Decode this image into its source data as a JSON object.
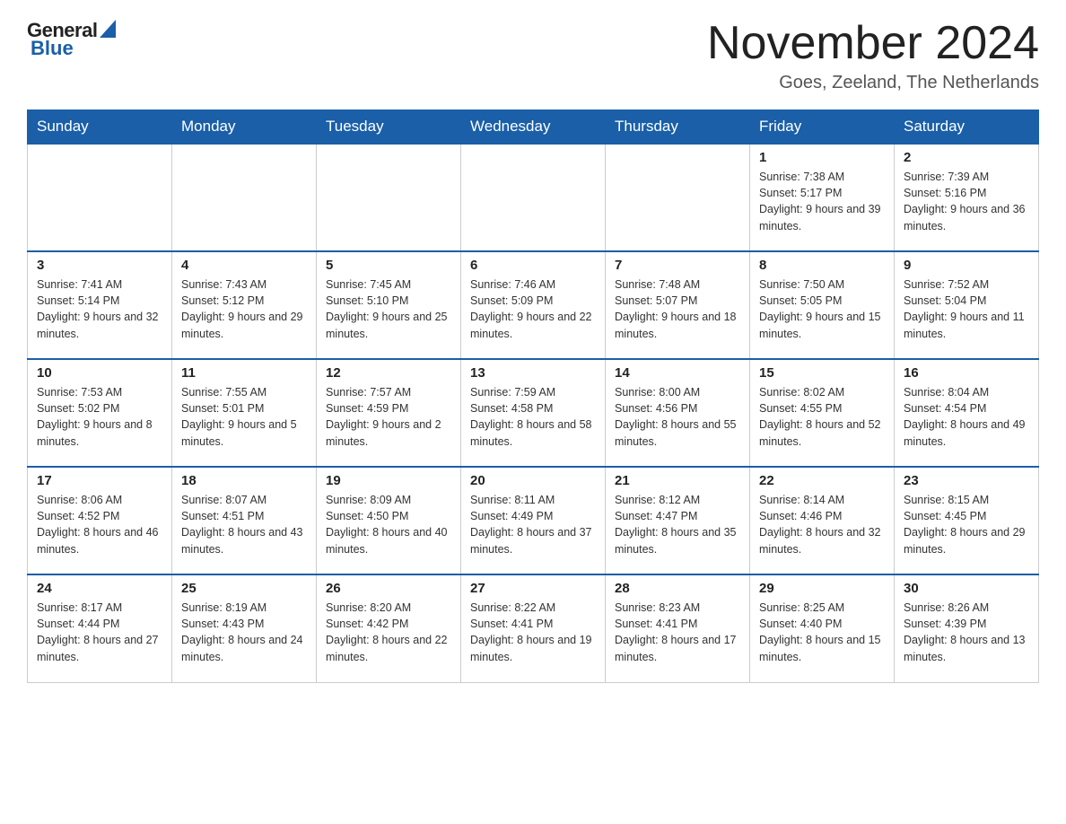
{
  "header": {
    "logo_general": "General",
    "logo_blue": "Blue",
    "month_title": "November 2024",
    "location": "Goes, Zeeland, The Netherlands"
  },
  "days_of_week": [
    "Sunday",
    "Monday",
    "Tuesday",
    "Wednesday",
    "Thursday",
    "Friday",
    "Saturday"
  ],
  "weeks": [
    [
      {
        "day": "",
        "info": ""
      },
      {
        "day": "",
        "info": ""
      },
      {
        "day": "",
        "info": ""
      },
      {
        "day": "",
        "info": ""
      },
      {
        "day": "",
        "info": ""
      },
      {
        "day": "1",
        "info": "Sunrise: 7:38 AM\nSunset: 5:17 PM\nDaylight: 9 hours and 39 minutes."
      },
      {
        "day": "2",
        "info": "Sunrise: 7:39 AM\nSunset: 5:16 PM\nDaylight: 9 hours and 36 minutes."
      }
    ],
    [
      {
        "day": "3",
        "info": "Sunrise: 7:41 AM\nSunset: 5:14 PM\nDaylight: 9 hours and 32 minutes."
      },
      {
        "day": "4",
        "info": "Sunrise: 7:43 AM\nSunset: 5:12 PM\nDaylight: 9 hours and 29 minutes."
      },
      {
        "day": "5",
        "info": "Sunrise: 7:45 AM\nSunset: 5:10 PM\nDaylight: 9 hours and 25 minutes."
      },
      {
        "day": "6",
        "info": "Sunrise: 7:46 AM\nSunset: 5:09 PM\nDaylight: 9 hours and 22 minutes."
      },
      {
        "day": "7",
        "info": "Sunrise: 7:48 AM\nSunset: 5:07 PM\nDaylight: 9 hours and 18 minutes."
      },
      {
        "day": "8",
        "info": "Sunrise: 7:50 AM\nSunset: 5:05 PM\nDaylight: 9 hours and 15 minutes."
      },
      {
        "day": "9",
        "info": "Sunrise: 7:52 AM\nSunset: 5:04 PM\nDaylight: 9 hours and 11 minutes."
      }
    ],
    [
      {
        "day": "10",
        "info": "Sunrise: 7:53 AM\nSunset: 5:02 PM\nDaylight: 9 hours and 8 minutes."
      },
      {
        "day": "11",
        "info": "Sunrise: 7:55 AM\nSunset: 5:01 PM\nDaylight: 9 hours and 5 minutes."
      },
      {
        "day": "12",
        "info": "Sunrise: 7:57 AM\nSunset: 4:59 PM\nDaylight: 9 hours and 2 minutes."
      },
      {
        "day": "13",
        "info": "Sunrise: 7:59 AM\nSunset: 4:58 PM\nDaylight: 8 hours and 58 minutes."
      },
      {
        "day": "14",
        "info": "Sunrise: 8:00 AM\nSunset: 4:56 PM\nDaylight: 8 hours and 55 minutes."
      },
      {
        "day": "15",
        "info": "Sunrise: 8:02 AM\nSunset: 4:55 PM\nDaylight: 8 hours and 52 minutes."
      },
      {
        "day": "16",
        "info": "Sunrise: 8:04 AM\nSunset: 4:54 PM\nDaylight: 8 hours and 49 minutes."
      }
    ],
    [
      {
        "day": "17",
        "info": "Sunrise: 8:06 AM\nSunset: 4:52 PM\nDaylight: 8 hours and 46 minutes."
      },
      {
        "day": "18",
        "info": "Sunrise: 8:07 AM\nSunset: 4:51 PM\nDaylight: 8 hours and 43 minutes."
      },
      {
        "day": "19",
        "info": "Sunrise: 8:09 AM\nSunset: 4:50 PM\nDaylight: 8 hours and 40 minutes."
      },
      {
        "day": "20",
        "info": "Sunrise: 8:11 AM\nSunset: 4:49 PM\nDaylight: 8 hours and 37 minutes."
      },
      {
        "day": "21",
        "info": "Sunrise: 8:12 AM\nSunset: 4:47 PM\nDaylight: 8 hours and 35 minutes."
      },
      {
        "day": "22",
        "info": "Sunrise: 8:14 AM\nSunset: 4:46 PM\nDaylight: 8 hours and 32 minutes."
      },
      {
        "day": "23",
        "info": "Sunrise: 8:15 AM\nSunset: 4:45 PM\nDaylight: 8 hours and 29 minutes."
      }
    ],
    [
      {
        "day": "24",
        "info": "Sunrise: 8:17 AM\nSunset: 4:44 PM\nDaylight: 8 hours and 27 minutes."
      },
      {
        "day": "25",
        "info": "Sunrise: 8:19 AM\nSunset: 4:43 PM\nDaylight: 8 hours and 24 minutes."
      },
      {
        "day": "26",
        "info": "Sunrise: 8:20 AM\nSunset: 4:42 PM\nDaylight: 8 hours and 22 minutes."
      },
      {
        "day": "27",
        "info": "Sunrise: 8:22 AM\nSunset: 4:41 PM\nDaylight: 8 hours and 19 minutes."
      },
      {
        "day": "28",
        "info": "Sunrise: 8:23 AM\nSunset: 4:41 PM\nDaylight: 8 hours and 17 minutes."
      },
      {
        "day": "29",
        "info": "Sunrise: 8:25 AM\nSunset: 4:40 PM\nDaylight: 8 hours and 15 minutes."
      },
      {
        "day": "30",
        "info": "Sunrise: 8:26 AM\nSunset: 4:39 PM\nDaylight: 8 hours and 13 minutes."
      }
    ]
  ]
}
